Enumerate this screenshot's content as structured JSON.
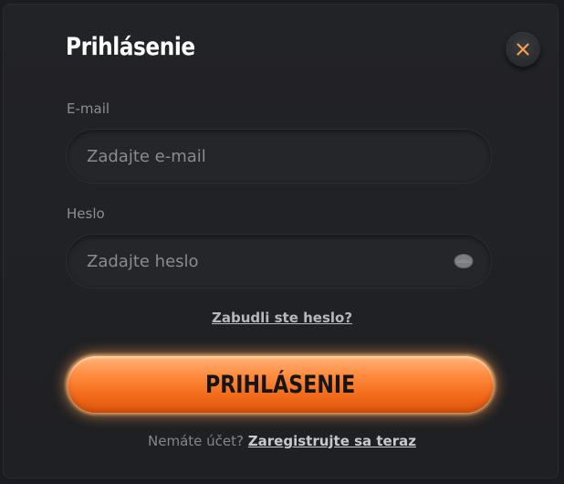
{
  "dialog": {
    "title": "Prihlásenie",
    "close_icon": "close-icon"
  },
  "email": {
    "label": "E-mail",
    "placeholder": "Zadajte e-mail",
    "value": ""
  },
  "password": {
    "label": "Heslo",
    "placeholder": "Zadajte heslo",
    "value": "",
    "toggle_icon": "eye-icon"
  },
  "forgot_password": {
    "label": "Zabudli ste heslo?"
  },
  "login_button": {
    "label": "PRIHLÁSENIE"
  },
  "register": {
    "prompt": "Nemáte účet?",
    "link_label": "Zaregistrujte sa teraz"
  },
  "colors": {
    "background": "#1f2023",
    "accent": "#ff8a3d",
    "close_x": "#f5a04a"
  }
}
